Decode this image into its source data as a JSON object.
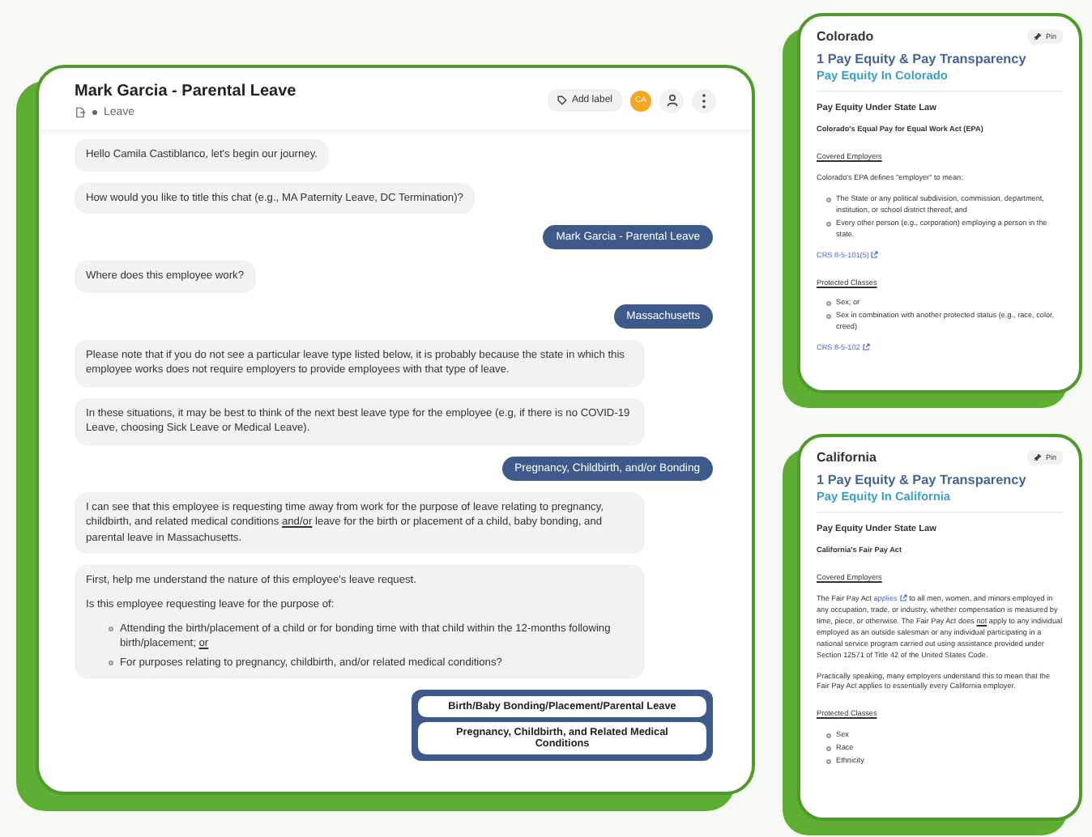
{
  "chat": {
    "title": "Mark Garcia - Parental Leave",
    "category": "Leave",
    "add_label": "Add label",
    "avatar": "CA",
    "messages": [
      {
        "kind": "bot",
        "blocks": [
          {
            "kind": "paragraph",
            "parts": [
              {
                "text": "Hello Camila Castiblanco, let's begin our journey.",
                "kind": "plain"
              }
            ]
          }
        ]
      },
      {
        "kind": "bot",
        "blocks": [
          {
            "kind": "paragraph",
            "parts": [
              {
                "text": "How would you like to title this chat (e.g., MA Paternity Leave, DC Termination)?",
                "kind": "plain"
              }
            ]
          }
        ]
      },
      {
        "kind": "user",
        "text": "Mark Garcia - Parental Leave"
      },
      {
        "kind": "bot",
        "blocks": [
          {
            "kind": "paragraph",
            "parts": [
              {
                "text": "Where does this employee work?",
                "kind": "plain"
              }
            ]
          }
        ]
      },
      {
        "kind": "user",
        "text": "Massachusetts"
      },
      {
        "kind": "bot",
        "blocks": [
          {
            "kind": "paragraph",
            "parts": [
              {
                "text": "Please note that if you do not see a particular leave type listed below, it is probably because the state in which this employee works does not require employers to provide employees with that type of leave.",
                "kind": "plain"
              }
            ]
          }
        ]
      },
      {
        "kind": "bot",
        "blocks": [
          {
            "kind": "paragraph",
            "parts": [
              {
                "text": "In these situations, it may be best to think of the next best leave type for the employee (e.g, if there is no COVID-19 Leave, choosing Sick Leave or Medical Leave).",
                "kind": "plain"
              }
            ]
          }
        ]
      },
      {
        "kind": "user",
        "text": "Pregnancy, Childbirth, and/or Bonding"
      },
      {
        "kind": "bot",
        "blocks": [
          {
            "kind": "paragraph",
            "parts": [
              {
                "text": "I can see that this employee is requesting time away from work for the purpose of leave relating to pregnancy, childbirth, and related medical conditions ",
                "kind": "plain"
              },
              {
                "text": "and/or",
                "kind": "underline"
              },
              {
                "text": " leave for the birth or placement of a child, baby bonding, and parental leave in Massachusetts.",
                "kind": "plain"
              }
            ]
          }
        ]
      },
      {
        "kind": "bot",
        "blocks": [
          {
            "kind": "paragraph",
            "parts": [
              {
                "text": "First, help me understand the nature of this employee's leave request.",
                "kind": "plain"
              }
            ]
          },
          {
            "kind": "paragraph",
            "parts": [
              {
                "text": "Is this employee requesting leave for the purpose of:",
                "kind": "plain"
              }
            ]
          },
          {
            "kind": "bullets",
            "items": [
              [
                {
                  "text": "Attending the birth/placement of a child or for bonding time with that child within the 12-months following birth/placement; ",
                  "kind": "plain"
                },
                {
                  "text": "or",
                  "kind": "underline"
                }
              ],
              [
                {
                  "text": "For purposes relating to pregnancy, childbirth, and/or related medical conditions?",
                  "kind": "plain"
                }
              ]
            ]
          }
        ]
      }
    ],
    "choices": [
      "Birth/Baby Bonding/Placement/Parental Leave",
      "Pregnancy, Childbirth, and Related Medical Conditions"
    ]
  },
  "cards": [
    {
      "state": "Colorado",
      "pin": "Pin",
      "number": "1",
      "topic": "Pay Equity & Pay Transparency",
      "subtopic": "Pay Equity In Colorado",
      "blocks": [
        {
          "kind": "title",
          "parts": [
            {
              "text": "Pay Equity Under State Law",
              "kind": "plain"
            }
          ]
        },
        {
          "kind": "subtitle",
          "parts": [
            {
              "text": "Colorado's Equal Pay for Equal Work Act (EPA)",
              "kind": "plain"
            }
          ]
        },
        {
          "kind": "heading",
          "parts": [
            {
              "text": "Covered Employers",
              "kind": "plain"
            }
          ]
        },
        {
          "kind": "paragraph",
          "parts": [
            {
              "text": "Colorado's EPA defines \"employer\" to mean:",
              "kind": "plain"
            }
          ]
        },
        {
          "kind": "bullets",
          "items": [
            [
              {
                "text": "The State or any political subdivision, commission, department, institution, or school district thereof; and",
                "kind": "plain"
              }
            ],
            [
              {
                "text": "Every other person (e.g., corporation) employing a person in the state.",
                "kind": "plain"
              }
            ]
          ]
        },
        {
          "kind": "link",
          "parts": [
            {
              "text": "CRS 8-5-101(5)",
              "kind": "link"
            }
          ]
        },
        {
          "kind": "heading",
          "parts": [
            {
              "text": "Protected Classes",
              "kind": "plain"
            }
          ]
        },
        {
          "kind": "bullets",
          "items": [
            [
              {
                "text": "Sex; or",
                "kind": "plain"
              }
            ],
            [
              {
                "text": "Sex in combination with another protected status (e.g., race, color, creed)",
                "kind": "plain"
              }
            ]
          ]
        },
        {
          "kind": "link",
          "parts": [
            {
              "text": "CRS 8-5-102",
              "kind": "link"
            }
          ]
        }
      ]
    },
    {
      "state": "California",
      "pin": "Pin",
      "number": "1",
      "topic": "Pay Equity & Pay Transparency",
      "subtopic": "Pay Equity In California",
      "blocks": [
        {
          "kind": "title",
          "parts": [
            {
              "text": "Pay Equity Under State Law",
              "kind": "plain"
            }
          ]
        },
        {
          "kind": "subtitle",
          "parts": [
            {
              "text": "California's Fair Pay Act",
              "kind": "plain"
            }
          ]
        },
        {
          "kind": "heading",
          "parts": [
            {
              "text": "Covered Employers",
              "kind": "plain"
            }
          ]
        },
        {
          "kind": "paragraph",
          "parts": [
            {
              "text": "The Fair Pay Act ",
              "kind": "plain"
            },
            {
              "text": "applies",
              "kind": "link"
            },
            {
              "text": " to all men, women, and minors employed in any occupation, trade, or industry, whether compensation is measured by time, piece, or otherwise. The Fair Pay Act does ",
              "kind": "plain"
            },
            {
              "text": "not",
              "kind": "underline"
            },
            {
              "text": " apply to any individual employed as an outside salesman or any individual participating in a national service program carried out using assistance provided under Section 12571 of Title 42 of the United States Code.",
              "kind": "plain"
            }
          ]
        },
        {
          "kind": "paragraph",
          "parts": [
            {
              "text": "Practically speaking, many employers understand this to mean that the Fair Pay Act applies to essentially every California employer.",
              "kind": "plain"
            }
          ]
        },
        {
          "kind": "heading",
          "parts": [
            {
              "text": "Protected Classes",
              "kind": "plain"
            }
          ]
        },
        {
          "kind": "bullets",
          "items": [
            [
              {
                "text": "Sex",
                "kind": "plain"
              }
            ],
            [
              {
                "text": "Race",
                "kind": "plain"
              }
            ],
            [
              {
                "text": "Ethnicity",
                "kind": "plain"
              }
            ]
          ]
        }
      ]
    }
  ]
}
